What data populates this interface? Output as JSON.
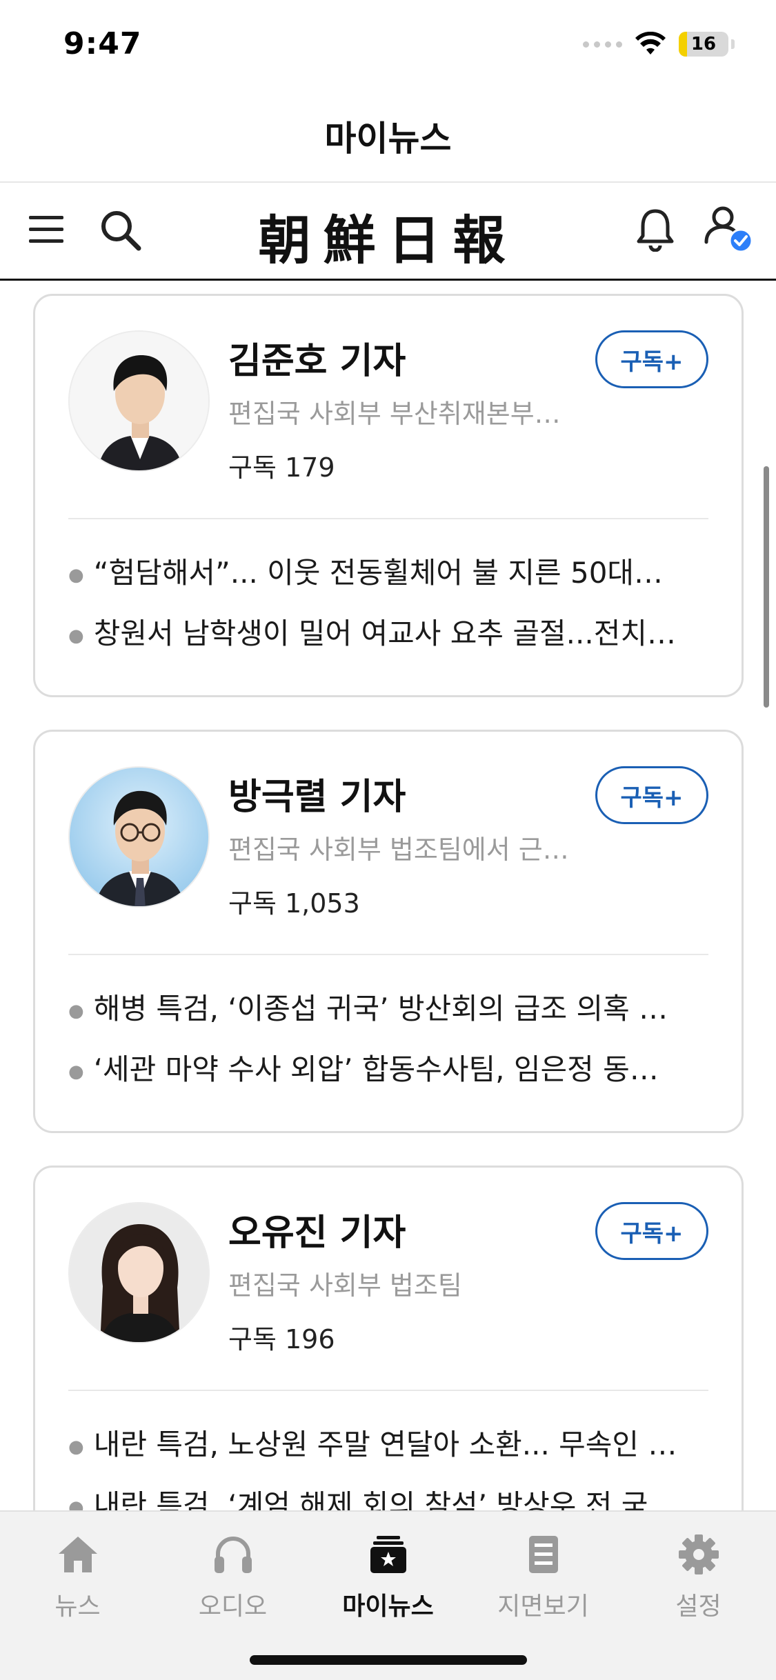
{
  "status_bar": {
    "time": "9:47",
    "battery": "16",
    "battery_level": 0.16
  },
  "page": {
    "title": "마이뉴스"
  },
  "masthead": {
    "title": "朝鮮日報"
  },
  "icons": {
    "menu": "menu-icon",
    "search": "search-icon",
    "bell": "bell-icon",
    "profile": "profile-check-icon"
  },
  "colors": {
    "accent": "#1a5fb4",
    "muted": "#9a9a9a",
    "card_border": "#dcdcdc"
  },
  "reporters": [
    {
      "name": "김준호 기자",
      "dept": "편집국 사회부 부산취재본부…",
      "subscribers": "구독 179",
      "subscribe_label": "구독+",
      "articles": [
        "“험담해서”... 이웃 전동휠체어 불 지른 50대…",
        "창원서 남학생이 밀어 여교사 요추 골절...전치…"
      ]
    },
    {
      "name": "방극렬 기자",
      "dept": "편집국 사회부 법조팀에서 근…",
      "subscribers": "구독 1,053",
      "subscribe_label": "구독+",
      "articles": [
        "해병 특검, ‘이종섭 귀국’ 방산회의 급조 의혹 …",
        "‘세관 마약 수사 외압’ 합동수사팀, 임은정 동…"
      ]
    },
    {
      "name": "오유진 기자",
      "dept": "편집국 사회부 법조팀",
      "subscribers": "구독 196",
      "subscribe_label": "구독+",
      "articles": [
        "내란 특검, 노상원 주말 연달아 소환... 무속인 …",
        "내란 특검, ‘계엄 해제 회의 참석’ 방상우 전 국…"
      ]
    }
  ],
  "tabs": [
    {
      "label": "뉴스",
      "icon": "home-icon",
      "active": false
    },
    {
      "label": "오디오",
      "icon": "headphones-icon",
      "active": false
    },
    {
      "label": "마이뉴스",
      "icon": "my-news-star-icon",
      "active": true
    },
    {
      "label": "지면보기",
      "icon": "newspaper-icon",
      "active": false
    },
    {
      "label": "설정",
      "icon": "gear-icon",
      "active": false
    }
  ]
}
